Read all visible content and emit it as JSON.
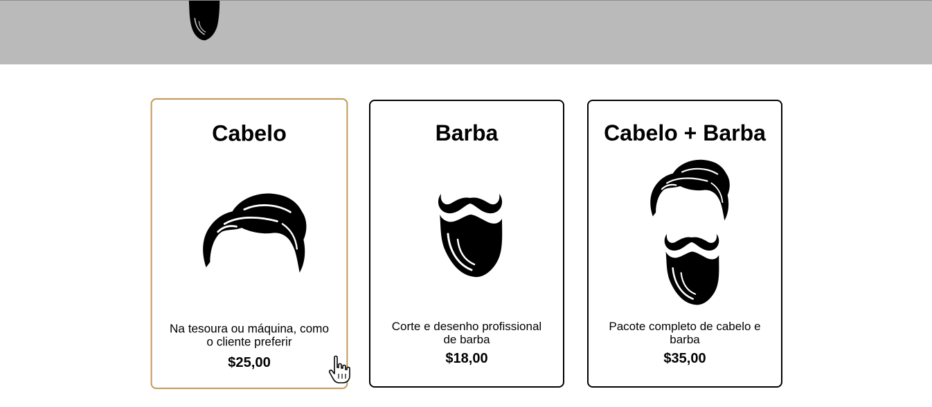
{
  "header": {
    "logo_icon": "beard-logo-icon",
    "background": "#bababa"
  },
  "services": [
    {
      "title": "Cabelo",
      "description": "Na tesoura ou máquina, como o cliente preferir",
      "price": "$25,00",
      "icon": "hair-icon",
      "active": true
    },
    {
      "title": "Barba",
      "description": "Corte e desenho profissional de barba",
      "price": "$18,00",
      "icon": "beard-icon",
      "active": false
    },
    {
      "title": "Cabelo + Barba",
      "description": "Pacote completo de cabelo e barba",
      "price": "$35,00",
      "icon": "hair-and-beard-icon",
      "active": false
    }
  ],
  "colors": {
    "active_border": "#c49a5a",
    "border": "#000000"
  },
  "cursor": "hand-pointer-icon"
}
